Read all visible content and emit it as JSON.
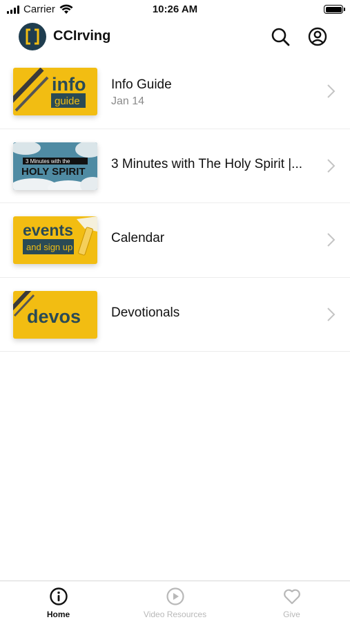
{
  "status_bar": {
    "carrier": "Carrier",
    "time": "10:26 AM"
  },
  "header": {
    "title": "CCIrving",
    "logo_icon": "bracket-logo-icon"
  },
  "list": [
    {
      "title": "Info Guide",
      "subtitle": "Jan 14",
      "thumb_text": [
        "info",
        "guide"
      ]
    },
    {
      "title": "3 Minutes with The Holy Spirit |...",
      "subtitle": "",
      "thumb_text": [
        "3 Minutes with the",
        "HOLY SPIRIT"
      ]
    },
    {
      "title": "Calendar",
      "subtitle": "",
      "thumb_text": [
        "events",
        "and sign up"
      ]
    },
    {
      "title": "Devotionals",
      "subtitle": "",
      "thumb_text": [
        "devos"
      ]
    }
  ],
  "tabs": [
    {
      "label": "Home",
      "icon": "info-circle-icon",
      "active": true
    },
    {
      "label": "Video Resources",
      "icon": "play-circle-icon",
      "active": false
    },
    {
      "label": "Give",
      "icon": "heart-icon",
      "active": false
    }
  ],
  "colors": {
    "accent_yellow": "#f2bd12",
    "brand_dark": "#1f3d4f",
    "thumb_text_dark": "#2a4a55"
  }
}
